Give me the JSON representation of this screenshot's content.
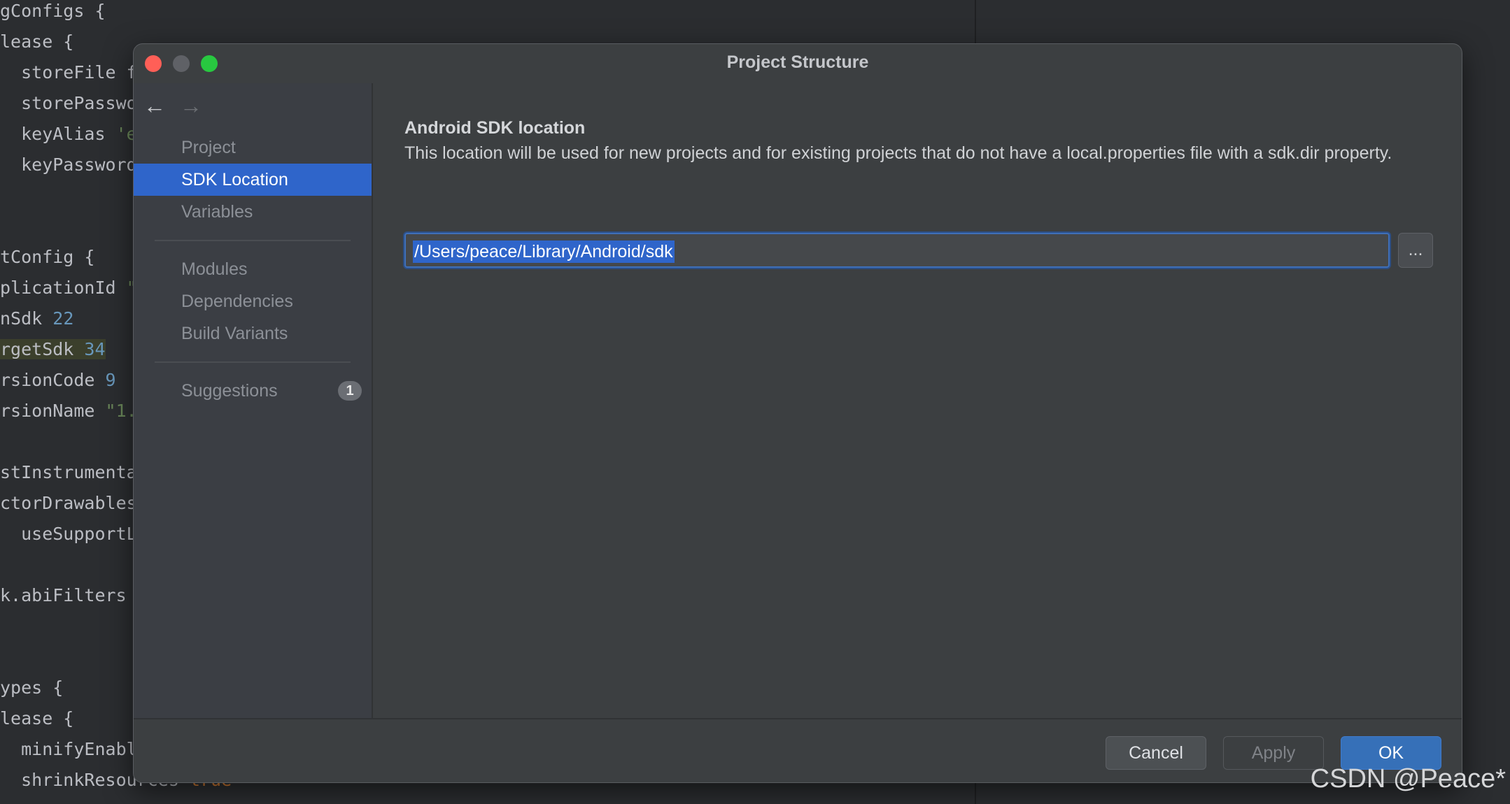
{
  "editor": {
    "lines": [
      {
        "segments": [
          {
            "t": "gConfigs {",
            "c": ""
          }
        ]
      },
      {
        "segments": [
          {
            "t": "lease {",
            "c": ""
          }
        ]
      },
      {
        "segments": [
          {
            "t": "  storeFile f",
            "c": ""
          }
        ]
      },
      {
        "segments": [
          {
            "t": "  storePasswo",
            "c": ""
          }
        ]
      },
      {
        "segments": [
          {
            "t": "  keyAlias ",
            "c": ""
          },
          {
            "t": "'e",
            "c": "str"
          }
        ]
      },
      {
        "segments": [
          {
            "t": "  keyPassword",
            "c": ""
          }
        ]
      },
      {
        "segments": [
          {
            "t": "",
            "c": ""
          }
        ]
      },
      {
        "segments": [
          {
            "t": "",
            "c": ""
          }
        ]
      },
      {
        "segments": [
          {
            "t": "tConfig {",
            "c": ""
          }
        ]
      },
      {
        "segments": [
          {
            "t": "plicationId ",
            "c": ""
          },
          {
            "t": "\"",
            "c": "str"
          }
        ]
      },
      {
        "segments": [
          {
            "t": "nSdk ",
            "c": ""
          },
          {
            "t": "22",
            "c": "num"
          }
        ]
      },
      {
        "segments": [
          {
            "t": "rgetSdk ",
            "c": "hl"
          },
          {
            "t": "34",
            "c": "numhl"
          }
        ]
      },
      {
        "segments": [
          {
            "t": "rsionCode ",
            "c": ""
          },
          {
            "t": "9",
            "c": "num"
          }
        ]
      },
      {
        "segments": [
          {
            "t": "rsionName ",
            "c": ""
          },
          {
            "t": "\"1.",
            "c": "str"
          }
        ]
      },
      {
        "segments": [
          {
            "t": "",
            "c": ""
          }
        ]
      },
      {
        "segments": [
          {
            "t": "stInstrumenta",
            "c": ""
          }
        ]
      },
      {
        "segments": [
          {
            "t": "ctorDrawables",
            "c": ""
          }
        ]
      },
      {
        "segments": [
          {
            "t": "  useSupportL",
            "c": ""
          }
        ]
      },
      {
        "segments": [
          {
            "t": "",
            "c": ""
          }
        ]
      },
      {
        "segments": [
          {
            "t": "k.abiFilters",
            "c": ""
          }
        ]
      },
      {
        "segments": [
          {
            "t": "",
            "c": ""
          }
        ]
      },
      {
        "segments": [
          {
            "t": "",
            "c": ""
          }
        ]
      },
      {
        "segments": [
          {
            "t": "ypes {",
            "c": ""
          }
        ]
      },
      {
        "segments": [
          {
            "t": "lease {",
            "c": ""
          }
        ]
      },
      {
        "segments": [
          {
            "t": "  minifyEnabl",
            "c": ""
          }
        ]
      },
      {
        "segments": [
          {
            "t": "  shrinkResources ",
            "c": ""
          },
          {
            "t": "true",
            "c": "kw"
          }
        ]
      }
    ]
  },
  "dialog": {
    "title": "Project Structure",
    "sidebar": {
      "back_icon": "←",
      "forward_icon": "→",
      "items": [
        {
          "label": "Project",
          "selected": false
        },
        {
          "label": "SDK Location",
          "selected": true
        },
        {
          "label": "Variables",
          "selected": false
        },
        {
          "label": "Modules",
          "selected": false
        },
        {
          "label": "Dependencies",
          "selected": false
        },
        {
          "label": "Build Variants",
          "selected": false
        },
        {
          "label": "Suggestions",
          "selected": false,
          "badge": "1"
        }
      ]
    },
    "content": {
      "section_title": "Android SDK location",
      "description": "This location will be used for new projects and for existing projects that do not have a local.properties file with a sdk.dir property.",
      "sdk_path": "/Users/peace/Library/Android/sdk",
      "browse_label": "..."
    },
    "footer": {
      "cancel_label": "Cancel",
      "apply_label": "Apply",
      "ok_label": "OK"
    }
  },
  "watermark": "CSDN @Peace*",
  "colors": {
    "accent": "#2f65ca",
    "ok_button": "#3670b8",
    "close": "#ff5f57",
    "maximize": "#28c840"
  }
}
